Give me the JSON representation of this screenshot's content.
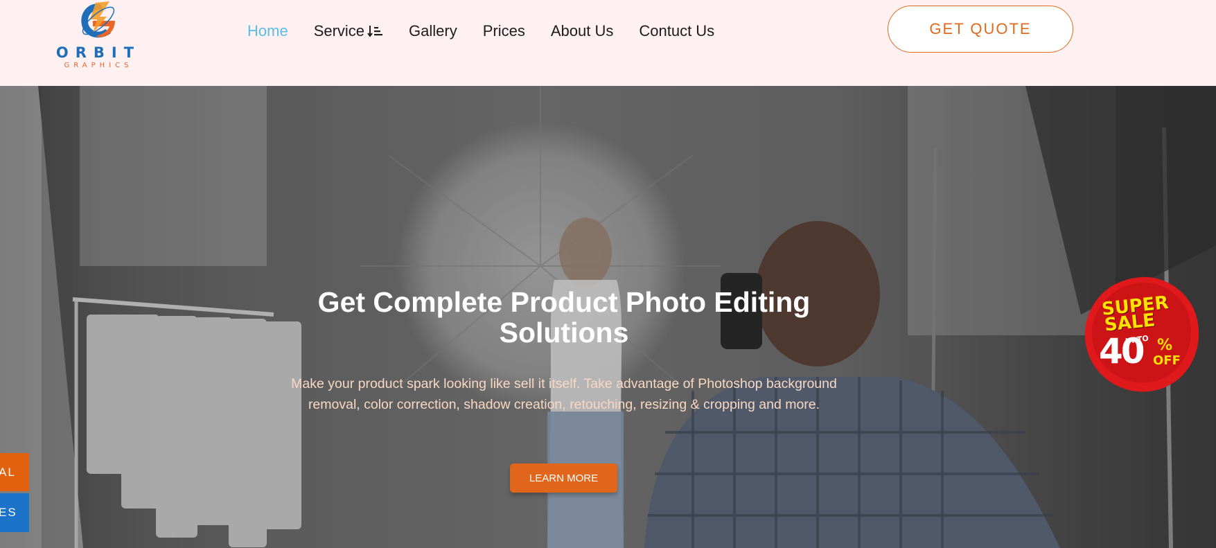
{
  "brand": {
    "name": "ORBIT",
    "tagline": "GRAPHICS",
    "colors": {
      "blue": "#1e6fb7",
      "orange": "#e8662a"
    }
  },
  "nav": {
    "items": [
      {
        "label": "Home",
        "active": true
      },
      {
        "label": "Service",
        "icon": "sort-icon"
      },
      {
        "label": "Gallery"
      },
      {
        "label": "Prices"
      },
      {
        "label": "About Us"
      },
      {
        "label": "Contuct Us"
      }
    ],
    "active_color": "#59bde5"
  },
  "header": {
    "quote_button": "GET QUOTE"
  },
  "hero": {
    "title": "Get Complete Product Photo Editing Solutions",
    "text": "Make your product spark looking like sell it itself. Take advantage of Photoshop background removal, color correction, shadow creation, retouching, resizing & cropping and more.",
    "cta": "LEARN MORE"
  },
  "side_tabs": [
    {
      "label": "AL",
      "color": "#e2620f"
    },
    {
      "label": "ES",
      "color": "#1d73c9"
    }
  ],
  "sale_badge": {
    "line1": "SUPER",
    "line2": "SALE",
    "upto": "UPTO",
    "amount": "40",
    "percent": "%",
    "off": "OFF"
  }
}
